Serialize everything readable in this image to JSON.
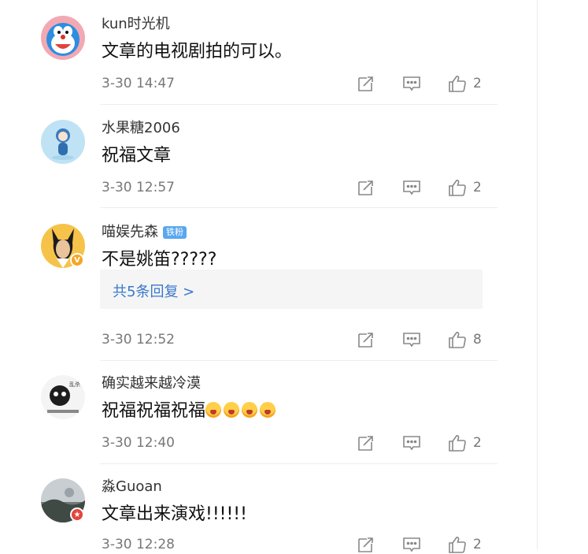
{
  "comments": [
    {
      "username": "kun时光机",
      "content": "文章的电视剧拍的可以。",
      "time": "3-30 14:47",
      "likes": "2"
    },
    {
      "username": "水果糖2006",
      "content": "祝福文章",
      "time": "3-30 12:57",
      "likes": "2"
    },
    {
      "username": "喵娱先森",
      "badge": "铁粉",
      "content": "不是姚笛?????",
      "replies": "共5条回复 >",
      "time": "3-30 12:52",
      "likes": "8",
      "verified": "gold-v"
    },
    {
      "username": "确实越来越冷漠",
      "content": "祝福祝福祝福",
      "emojis": [
        "cry-laugh-emoji",
        "cry-laugh-emoji",
        "cry-laugh-emoji",
        "cry-laugh-emoji"
      ],
      "time": "3-30 12:40",
      "likes": "2"
    },
    {
      "username": "淼Guoan",
      "content": "文章出来演戏!!!!!!",
      "time": "3-30 12:28",
      "likes": "2",
      "verified": "red-star"
    }
  ],
  "icons": {
    "repost": "repost-icon",
    "comment": "comment-icon",
    "like": "thumbs-up-icon"
  },
  "colors": {
    "link": "#3a78c9",
    "fan_badge": "#5aa7ee",
    "verified_gold": "#f5a623",
    "verified_red": "#e5433b",
    "meta": "#777777"
  }
}
